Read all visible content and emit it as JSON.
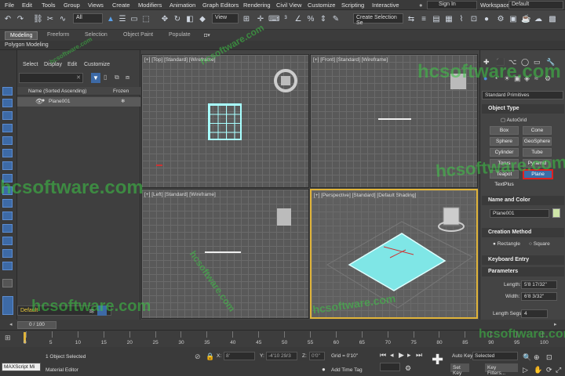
{
  "menu": {
    "items": [
      "File",
      "Edit",
      "Tools",
      "Group",
      "Views",
      "Create",
      "Modifiers",
      "Animation",
      "Graph Editors",
      "Rendering",
      "Civil View",
      "Customize",
      "Scripting",
      "Interactive"
    ],
    "sign_in": "Sign In",
    "workspaces_label": "Workspaces:",
    "workspaces_value": "Default"
  },
  "toolbar": {
    "selection_filter": "All",
    "ref_coord": "View",
    "selection_set": "Create Selection Se"
  },
  "ribbon": {
    "tabs": [
      "Modeling",
      "Freeform",
      "Selection",
      "Object Paint",
      "Populate"
    ],
    "active_tab": "Modeling",
    "subtitle": "Polygon Modeling"
  },
  "explorer": {
    "menu": [
      "Select",
      "Display",
      "Edit",
      "Customize"
    ],
    "col_name": "Name (Sorted Ascending)",
    "col_frozen": "Frozen",
    "rows": [
      {
        "name": "Plane001",
        "frozen": "❄"
      }
    ],
    "layer": "Default"
  },
  "viewports": {
    "top": "[+] [Top] [Standard] [Wireframe]",
    "front": "[+] [Front] [Standard] [Wireframe]",
    "left": "[+] [Left] [Standard] [Wireframe]",
    "perspective": "[+] [Perspective] [Standard] [Default Shading]"
  },
  "command_panel": {
    "category": "Standard Primitives",
    "object_type": "Object Type",
    "autogrid": "AutoGrid",
    "buttons": [
      "Box",
      "Cone",
      "Sphere",
      "GeoSphere",
      "Cylinder",
      "Tube",
      "Torus",
      "Pyramid",
      "Teapot",
      "Plane",
      "TextPlus"
    ],
    "selected_button": "Plane",
    "name_and_color": "Name and Color",
    "object_name": "Plane001",
    "creation_method": "Creation Method",
    "method_rectangle": "Rectangle",
    "method_square": "Square",
    "keyboard_entry": "Keyboard Entry",
    "parameters": "Parameters",
    "length_label": "Length:",
    "length_value": "5'8 17/32\"",
    "width_label": "Width:",
    "width_value": "6'8 3/32\"",
    "length_segs_label": "Length Segs:",
    "length_segs_value": "4"
  },
  "timeline": {
    "slider": "0 / 100",
    "ticks": [
      "0",
      "5",
      "10",
      "15",
      "20",
      "25",
      "30",
      "35",
      "40",
      "45",
      "50",
      "55",
      "60",
      "65",
      "70",
      "75",
      "80",
      "85",
      "90",
      "95",
      "100"
    ]
  },
  "status": {
    "maxscript": "MAXScript Mi",
    "selected": "1 Object Selected",
    "material_editor": "Material Editor",
    "x_label": "X:",
    "x_value": "8'",
    "y_label": "Y:",
    "y_value": "-4'10 29/3",
    "z_label": "Z:",
    "z_value": "0'0\"",
    "grid": "Grid = 0'10\"",
    "add_time_tag": "Add Time Tag",
    "auto_key": "Auto Key",
    "set_key": "Set Key",
    "selected_dd": "Selected",
    "key_filters": "Key Filters..."
  },
  "watermark": "hcsoftware.com",
  "colors": {
    "accent": "#3a6ea8",
    "highlight_red": "#e02020",
    "plane_cyan": "#7fe6e6",
    "active_viewport": "#e0b43a"
  }
}
